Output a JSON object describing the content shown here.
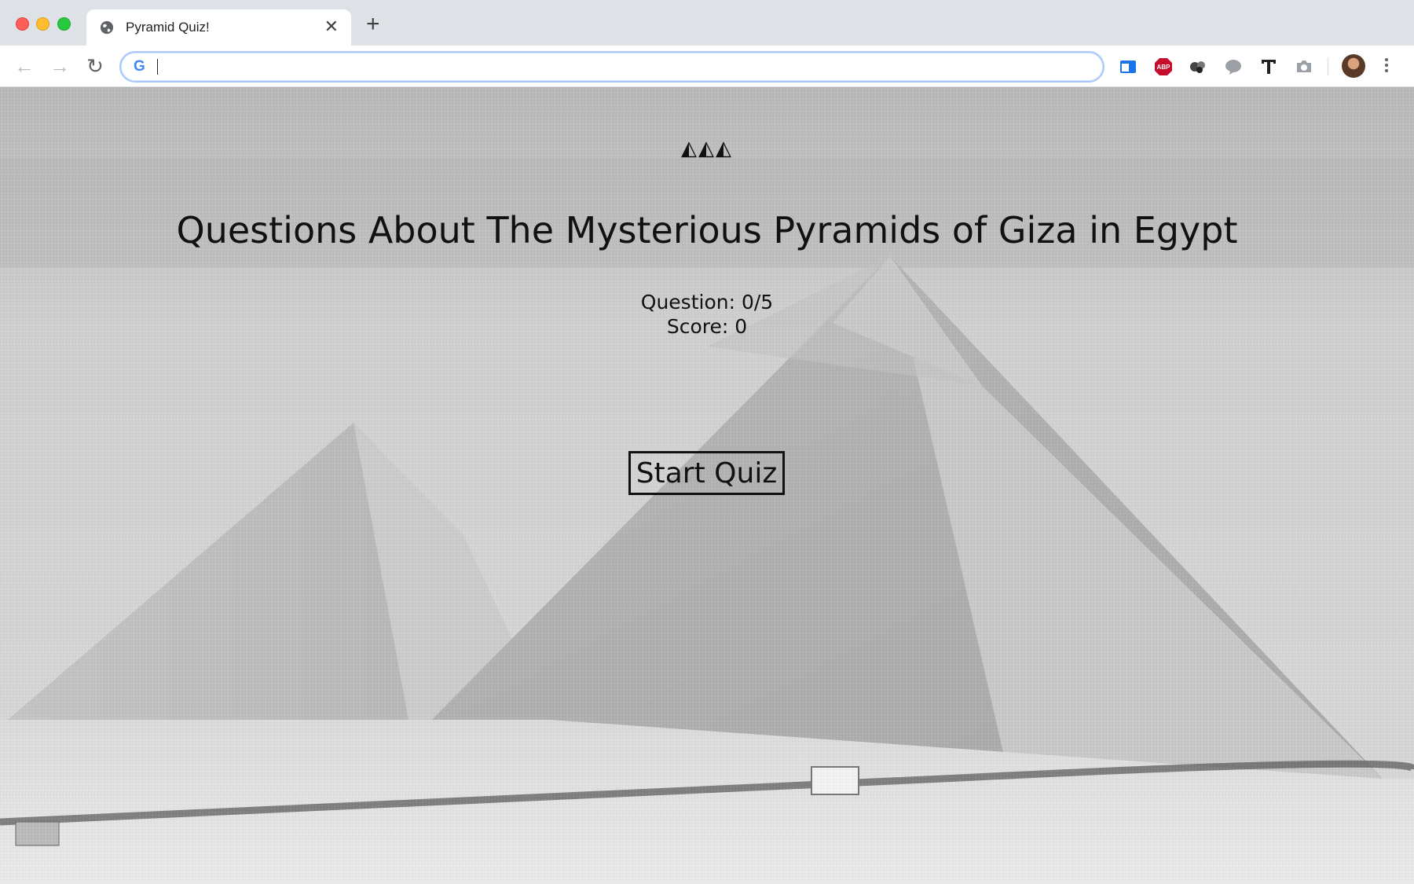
{
  "browser": {
    "tab_title": "Pyramid Quiz!",
    "tab_close_glyph": "✕",
    "new_tab_glyph": "+",
    "omnibox_value": "",
    "omnibox_logo": "G",
    "extensions": [
      "window-icon",
      "adblock-plus-icon",
      "extension-dots-icon",
      "speech-bubble-icon",
      "text-tool-icon",
      "camera-icon"
    ],
    "adblock_label": "ABP"
  },
  "page": {
    "decor_icons": "◭◭◭",
    "title": "Questions About The Mysterious Pyramids of Giza in Egypt",
    "question_label": "Question: 0/5",
    "score_label": "Score: 0",
    "start_button": "Start Quiz"
  },
  "colors": {
    "accent_focus": "#a8c7fa",
    "text": "#111111"
  }
}
